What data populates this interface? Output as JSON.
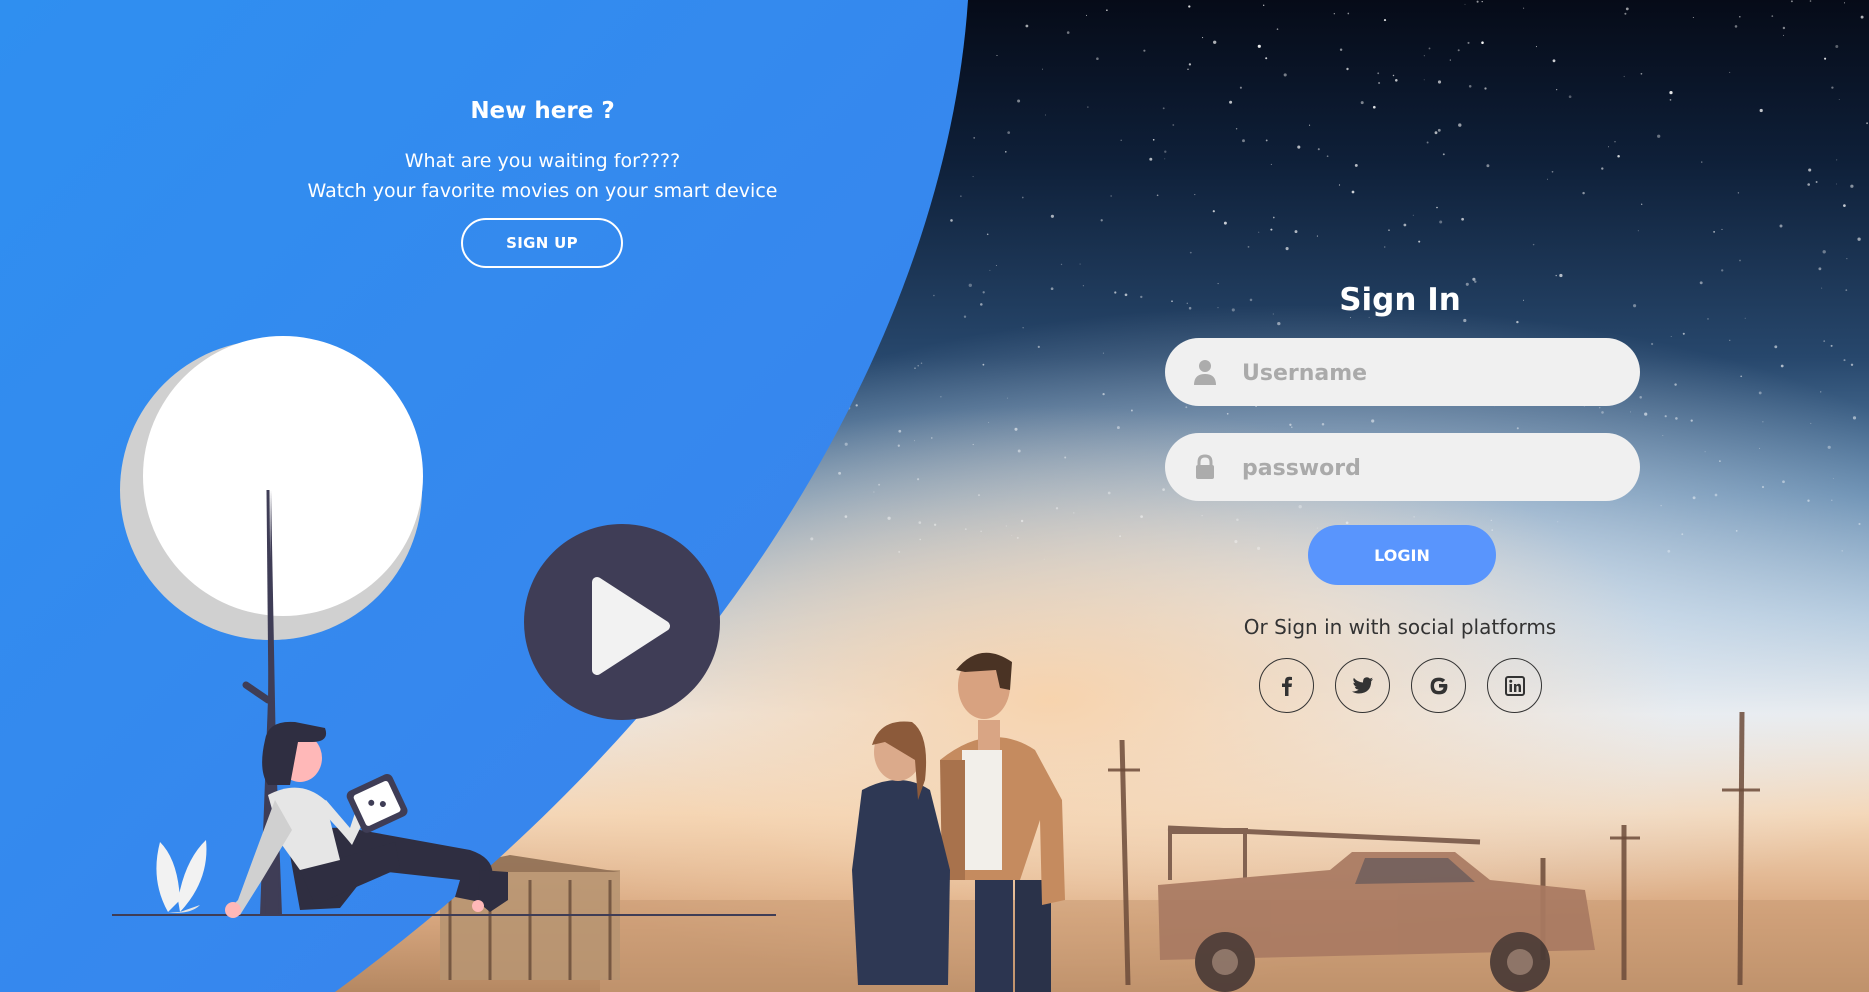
{
  "left_panel": {
    "title": "New here ?",
    "text_line1": "What are you waiting for????",
    "text_line2": "Watch your favorite movies on your smart device",
    "signup_label": "SIGN UP"
  },
  "sign_in": {
    "title": "Sign In",
    "username_placeholder": "Username",
    "password_placeholder": "password",
    "login_label": "LOGIN",
    "social_text": "Or Sign in with social platforms",
    "social_icons": [
      "facebook-icon",
      "twitter-icon",
      "google-icon",
      "linkedin-icon"
    ]
  },
  "colors": {
    "panel_blue": "#2f8ff0",
    "login_blue": "#5995fd",
    "input_bg": "#f0f0f0",
    "illustration_dark": "#3f3d56"
  }
}
